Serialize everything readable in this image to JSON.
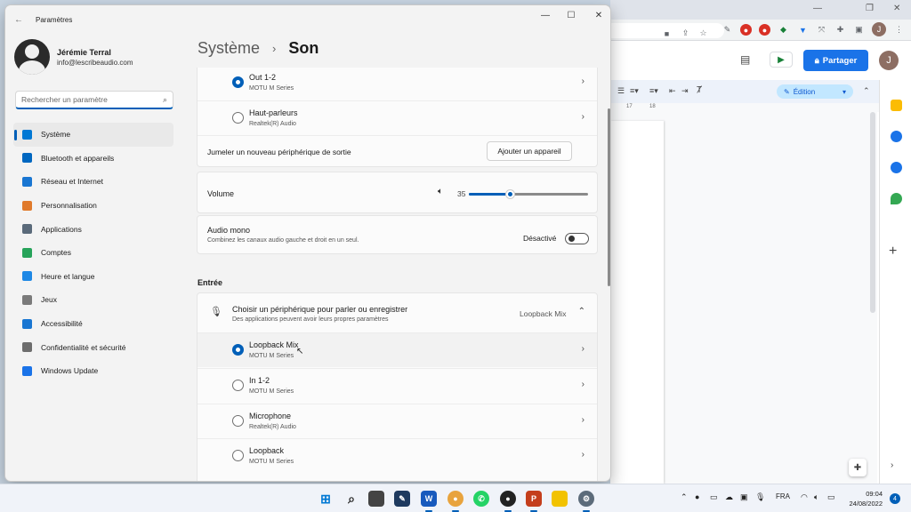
{
  "window": {
    "title": "Paramètres",
    "back_icon": "←"
  },
  "profile": {
    "name": "Jérémie Terral",
    "email": "info@lescribeaudio.com"
  },
  "search": {
    "placeholder": "Rechercher un paramètre"
  },
  "nav": {
    "items": [
      {
        "label": "Système",
        "icon": "monitor-icon",
        "color": "#0078d4",
        "active": true
      },
      {
        "label": "Bluetooth et appareils",
        "icon": "bluetooth-icon",
        "color": "#0067c0"
      },
      {
        "label": "Réseau et Internet",
        "icon": "wifi-icon",
        "color": "#1976d2"
      },
      {
        "label": "Personnalisation",
        "icon": "brush-icon",
        "color": "#e07a2b"
      },
      {
        "label": "Applications",
        "icon": "apps-icon",
        "color": "#5a6a7a"
      },
      {
        "label": "Comptes",
        "icon": "person-icon",
        "color": "#27a35a"
      },
      {
        "label": "Heure et langue",
        "icon": "globe-clock-icon",
        "color": "#1e88e5"
      },
      {
        "label": "Jeux",
        "icon": "gamepad-icon",
        "color": "#7a7a7a"
      },
      {
        "label": "Accessibilité",
        "icon": "accessibility-icon",
        "color": "#1976d2"
      },
      {
        "label": "Confidentialité et sécurité",
        "icon": "shield-icon",
        "color": "#6d6d6d"
      },
      {
        "label": "Windows Update",
        "icon": "update-icon",
        "color": "#1a73e8"
      }
    ]
  },
  "breadcrumb": {
    "parent": "Système",
    "separator": "›",
    "current": "Son"
  },
  "output": {
    "devices": [
      {
        "name": "Out 1-2",
        "sub": "MOTU M Series",
        "selected": true
      },
      {
        "name": "Haut-parleurs",
        "sub": "Realtek(R) Audio",
        "selected": false
      }
    ],
    "pair_label": "Jumeler un nouveau périphérique de sortie",
    "add_button": "Ajouter un appareil"
  },
  "volume": {
    "label": "Volume",
    "value": "35",
    "level": 0.35
  },
  "mono": {
    "label": "Audio mono",
    "sub": "Combinez les canaux audio gauche et droit en un seul.",
    "state": "Désactivé"
  },
  "input": {
    "section": "Entrée",
    "choose_title": "Choisir un périphérique pour parler ou enregistrer",
    "choose_sub": "Des applications peuvent avoir leurs propres paramètres",
    "selected": "Loopback Mix",
    "devices": [
      {
        "name": "Loopback Mix",
        "sub": "MOTU M Series",
        "selected": true
      },
      {
        "name": "In 1-2",
        "sub": "MOTU M Series",
        "selected": false
      },
      {
        "name": "Microphone",
        "sub": "Realtek(R) Audio",
        "selected": false
      },
      {
        "name": "Loopback",
        "sub": "MOTU M Series",
        "selected": false
      }
    ]
  },
  "browser": {
    "share_label": "Partager",
    "avatar_letter": "J",
    "mode_label": "Édition",
    "ruler": [
      "17",
      "18"
    ]
  },
  "taskbar": {
    "language": "FRA",
    "time": "09:04",
    "date": "24/08/2022",
    "notifications": "4"
  }
}
